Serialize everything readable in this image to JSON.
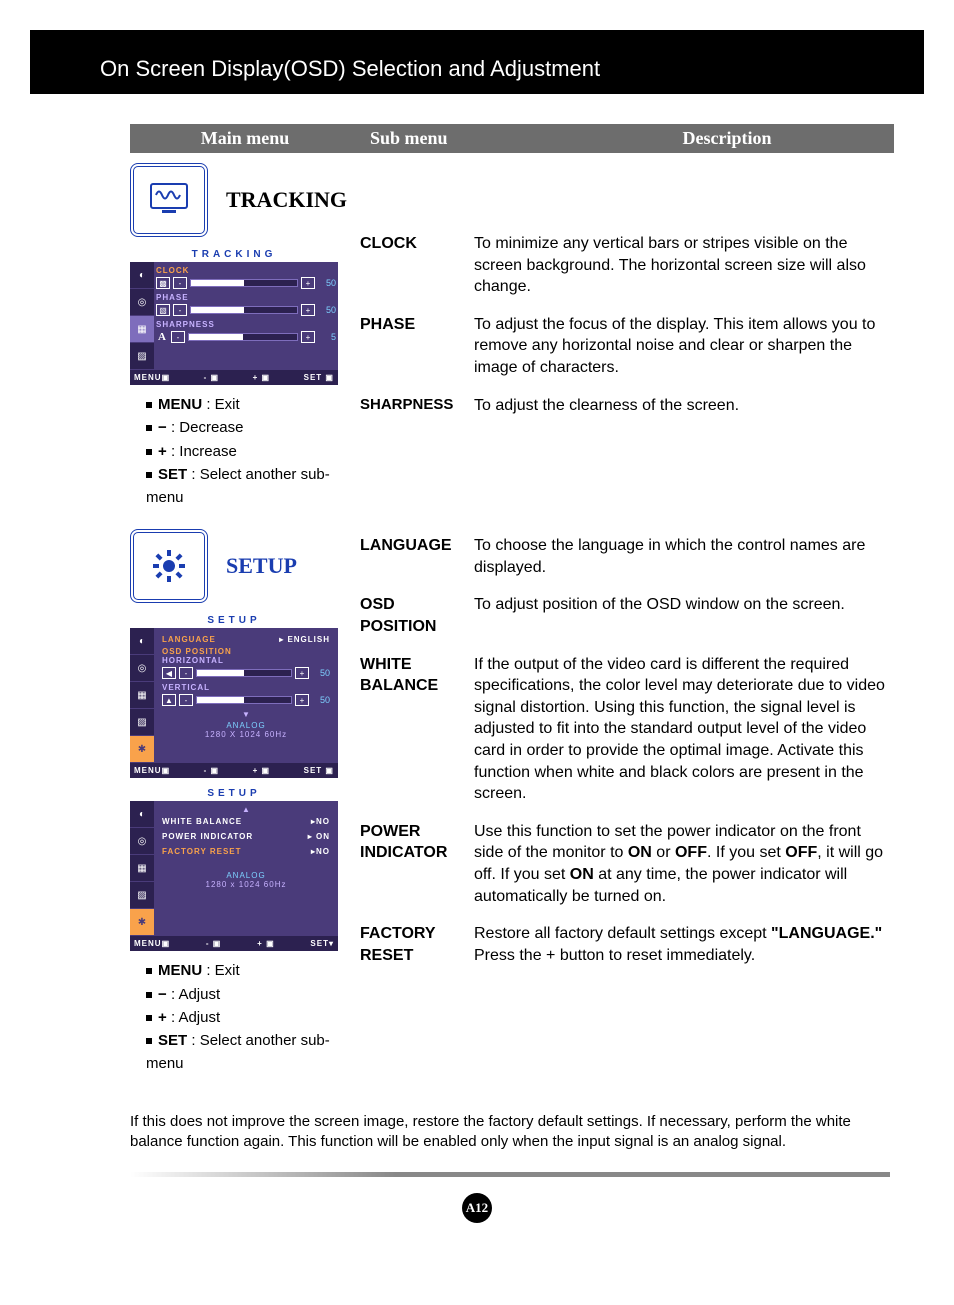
{
  "header": "On Screen Display(OSD) Selection and Adjustment",
  "table_header": {
    "main": "Main menu",
    "sub": "Sub menu",
    "desc": "Description"
  },
  "tracking": {
    "title": "TRACKING",
    "osd_title": "TRACKING",
    "items": {
      "clock": {
        "label": "CLOCK",
        "value": "50"
      },
      "phase": {
        "label": "PHASE",
        "value": "50"
      },
      "sharpness": {
        "label": "SHARPNESS",
        "glyph": "A",
        "value": "5"
      }
    },
    "footer": {
      "menu": "MENU",
      "minus": "-",
      "plus": "+",
      "set": "SET"
    },
    "legend": [
      {
        "key": "MENU",
        "text": ": Exit"
      },
      {
        "key": "−",
        "text": ": Decrease"
      },
      {
        "key": "+",
        "text": ": Increase"
      },
      {
        "key": "SET",
        "text": ": Select another sub-menu"
      }
    ],
    "desc": {
      "clock": {
        "sub": "CLOCK",
        "text": "To minimize any vertical bars or stripes visible on the screen background. The horizontal screen size will also change."
      },
      "phase": {
        "sub": "PHASE",
        "text": "To adjust the focus of the display. This item allows you to remove any horizontal noise and clear or sharpen the image of characters."
      },
      "sharpness": {
        "sub": "SHARPNESS",
        "text": "To adjust the clearness of the screen."
      }
    }
  },
  "setup": {
    "title": "SETUP",
    "osd_title": "SETUP",
    "panel1": {
      "language": {
        "label": "LANGUAGE",
        "value": "ENGLISH"
      },
      "osd_pos_label": "OSD POSITION",
      "horizontal": {
        "label": "HORIZONTAL",
        "value": "50"
      },
      "vertical": {
        "label": "VERTICAL",
        "value": "50"
      },
      "analog": "ANALOG",
      "mode": "1280 X 1024 60Hz"
    },
    "panel2": {
      "white_balance": {
        "label": "WHITE BALANCE",
        "value": "NO"
      },
      "power_indicator": {
        "label": "POWER INDICATOR",
        "value": "ON"
      },
      "factory_reset": {
        "label": "FACTORY RESET",
        "value": "NO"
      },
      "analog": "ANALOG",
      "mode": "1280 x 1024 60Hz"
    },
    "footer": {
      "menu": "MENU",
      "minus": "-",
      "plus": "+",
      "set": "SET"
    },
    "legend": [
      {
        "key": "MENU",
        "text": ": Exit"
      },
      {
        "key": "−",
        "text": ": Adjust"
      },
      {
        "key": "+",
        "text": ": Adjust"
      },
      {
        "key": "SET",
        "text": ": Select another sub-menu"
      }
    ],
    "desc": {
      "language": {
        "sub": "LANGUAGE",
        "text": "To choose the language in which the control names are displayed."
      },
      "osd_position": {
        "sub": "OSD POSITION",
        "text": "To adjust position of the OSD window on the screen."
      },
      "white_balance": {
        "sub": "WHITE BALANCE",
        "text": "If the output of the video card is different the required specifications, the color level may deteriorate due to video signal distortion. Using this function, the signal level is adjusted to fit into the standard output level of the video card in order to provide the optimal image. Activate this function when white and black colors are present in the screen."
      },
      "power_indicator": {
        "sub": "POWER INDICATOR",
        "pre": "Use this function to set the power indicator on the front side of the monitor to ",
        "on": "ON",
        "or": " or ",
        "off": "OFF",
        "post1": ". If you set ",
        "off2": "OFF",
        "post2": ", it will go off. If you set ",
        "on2": "ON",
        "post3": " at any time, the power indicator will automatically be turned on."
      },
      "factory_reset": {
        "sub": "FACTORY RESET",
        "pre": "Restore all factory default settings except ",
        "lang": "\"LANGUAGE.\"",
        "post": " Press the  +  button to reset immediately."
      }
    }
  },
  "footer_note": "If this does not improve the screen image, restore the factory default settings. If necessary, perform the white balance function again. This function will be enabled only when the input signal is an analog signal.",
  "page_number": "A12"
}
